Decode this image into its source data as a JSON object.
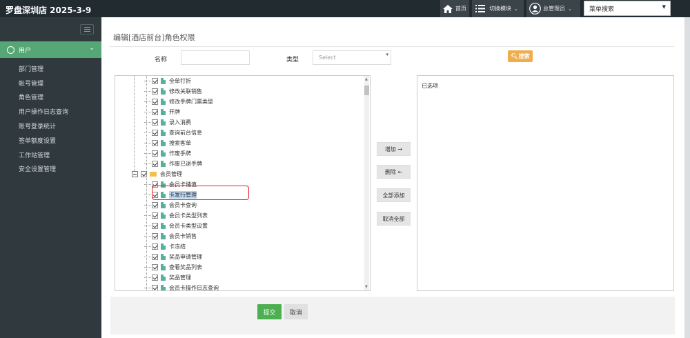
{
  "topbar": {
    "title": "罗盘深圳店 2025-3-9",
    "home_label": "首页",
    "switch_label": "切换模块",
    "user_label": "总管理员",
    "menu_search_placeholder": "菜单搜索"
  },
  "sidebar": {
    "active_section": "用户",
    "items": [
      "部门管理",
      "帐号管理",
      "角色管理",
      "用户操作日志查询",
      "账号登录统计",
      "签单额度设置",
      "工作站管理",
      "安全设置管理"
    ]
  },
  "page": {
    "title": "编辑[酒店前台]角色权限",
    "name_label": "名称",
    "name_value": "",
    "type_label": "类型",
    "type_placeholder": "Select",
    "search_button": "搜索"
  },
  "tree": {
    "items": [
      {
        "label": "全单打折",
        "level": 2,
        "icon": "doc-icon"
      },
      {
        "label": "修改关联销售",
        "level": 2,
        "icon": "doc-icon"
      },
      {
        "label": "修改手牌门票类型",
        "level": 2,
        "icon": "doc-icon"
      },
      {
        "label": "开牌",
        "level": 2,
        "icon": "doc-icon"
      },
      {
        "label": "录入消费",
        "level": 2,
        "icon": "doc-icon"
      },
      {
        "label": "查询前台信息",
        "level": 2,
        "icon": "doc-icon"
      },
      {
        "label": "搜索客单",
        "level": 2,
        "icon": "doc-icon"
      },
      {
        "label": "作废手牌",
        "level": 2,
        "icon": "doc-icon"
      },
      {
        "label": "作废已退手牌",
        "level": 2,
        "icon": "doc-icon"
      },
      {
        "label": "会员管理",
        "level": 1,
        "icon": "folder-icon"
      },
      {
        "label": "会员卡储值",
        "level": 2,
        "icon": "doc-icon"
      },
      {
        "label": "卡发行管理",
        "level": 2,
        "icon": "doc-icon",
        "selected": true
      },
      {
        "label": "会员卡查询",
        "level": 2,
        "icon": "doc-icon"
      },
      {
        "label": "会员卡类型列表",
        "level": 2,
        "icon": "doc-icon"
      },
      {
        "label": "会员卡类型设置",
        "level": 2,
        "icon": "doc-icon"
      },
      {
        "label": "会员卡销售",
        "level": 2,
        "icon": "doc-icon"
      },
      {
        "label": "卡冻结",
        "level": 2,
        "icon": "doc-icon"
      },
      {
        "label": "奖品申请管理",
        "level": 2,
        "icon": "doc-icon"
      },
      {
        "label": "查看奖品列表",
        "level": 2,
        "icon": "doc-icon"
      },
      {
        "label": "奖品管理",
        "level": 2,
        "icon": "doc-icon"
      },
      {
        "label": "会员卡操作日志查询",
        "level": 2,
        "icon": "doc-icon"
      }
    ]
  },
  "actions": {
    "add": "增加 →",
    "remove": "删除 ←",
    "add_all": "全部添加",
    "cancel_all": "取消全部"
  },
  "selected_panel": {
    "label": "已选项"
  },
  "footer": {
    "submit": "提交",
    "cancel": "取消"
  },
  "colors": {
    "sidebar_active": "#55a876",
    "search_button": "#f0ad4e",
    "submit": "#4caf50",
    "highlight": "#e02020"
  }
}
